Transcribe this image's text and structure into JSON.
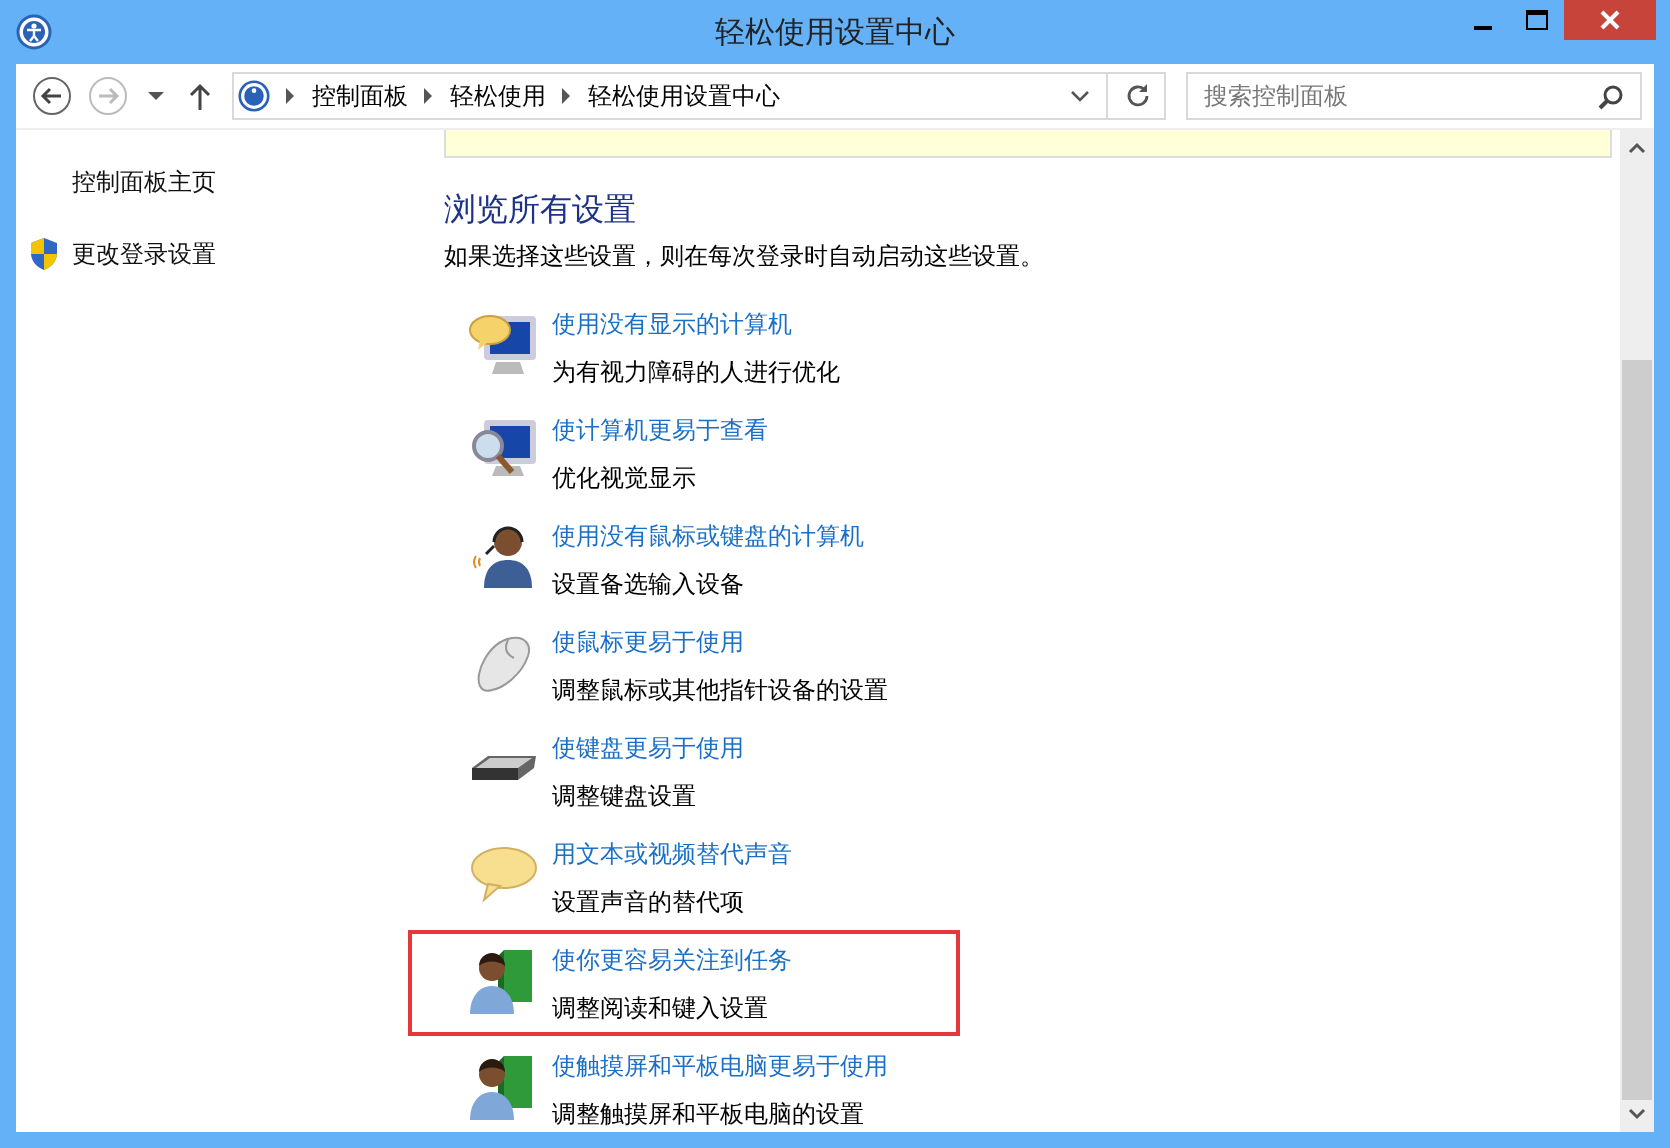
{
  "window": {
    "title": "轻松使用设置中心"
  },
  "address": {
    "crumbs": [
      "控制面板",
      "轻松使用",
      "轻松使用设置中心"
    ]
  },
  "search": {
    "placeholder": "搜索控制面板"
  },
  "sidebar": {
    "items": [
      {
        "label": "控制面板主页",
        "kind": "plain"
      },
      {
        "label": "更改登录设置",
        "kind": "shield"
      }
    ]
  },
  "section": {
    "title": "浏览所有设置",
    "description": "如果选择这些设置，则在每次登录时自动启动这些设置。"
  },
  "settings": [
    {
      "kind": "monitor-bubble",
      "title": "使用没有显示的计算机",
      "subtitle": "为有视力障碍的人进行优化",
      "highlighted": false
    },
    {
      "kind": "monitor-magnifier",
      "title": "使计算机更易于查看",
      "subtitle": "优化视觉显示",
      "highlighted": false
    },
    {
      "kind": "person-headset",
      "title": "使用没有鼠标或键盘的计算机",
      "subtitle": "设置备选输入设备",
      "highlighted": false
    },
    {
      "kind": "mouse",
      "title": "使鼠标更易于使用",
      "subtitle": "调整鼠标或其他指针设备的设置",
      "highlighted": false
    },
    {
      "kind": "keyboard",
      "title": "使键盘更易于使用",
      "subtitle": "调整键盘设置",
      "highlighted": false
    },
    {
      "kind": "bubble",
      "title": "用文本或视频替代声音",
      "subtitle": "设置声音的替代项",
      "highlighted": false
    },
    {
      "kind": "person-book",
      "title": "使你更容易关注到任务",
      "subtitle": "调整阅读和键入设置",
      "highlighted": true
    },
    {
      "kind": "person-book",
      "title": "使触摸屏和平板电脑更易于使用",
      "subtitle": "调整触摸屏和平板电脑的设置",
      "highlighted": false
    }
  ]
}
